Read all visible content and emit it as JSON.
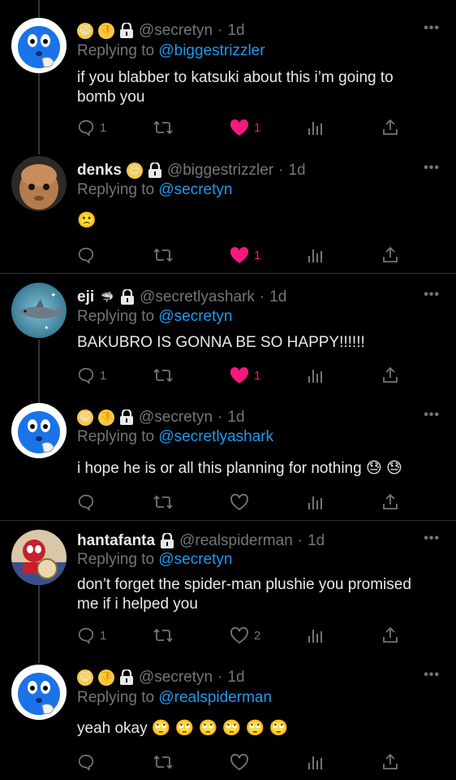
{
  "tweets": [
    {
      "author_name": "",
      "emojis": [
        "😹",
        "👎"
      ],
      "handle": "@secretyn",
      "time": "1d",
      "replying_prefix": "Replying to",
      "replying_to": "@biggestrizzler",
      "text_lines": [
        "if you blabber to katsuki about this i’m going to",
        "bomb you"
      ],
      "reply_count": "1",
      "retweet_count": "",
      "like_count": "1",
      "liked": true
    },
    {
      "author_name": "denks",
      "emojis": [
        "😊"
      ],
      "handle": "@biggestrizzler",
      "time": "1d",
      "replying_prefix": "Replying to",
      "replying_to": "@secretyn",
      "text_lines": [
        "🙁"
      ],
      "reply_count": "",
      "retweet_count": "",
      "like_count": "1",
      "liked": true
    },
    {
      "author_name": "eji",
      "emojis": [
        "🦈"
      ],
      "handle": "@secretlyashark",
      "time": "1d",
      "replying_prefix": "Replying to",
      "replying_to": "@secretyn",
      "text_lines": [
        "BAKUBRO IS GONNA BE SO HAPPY!!!!!!"
      ],
      "reply_count": "1",
      "retweet_count": "",
      "like_count": "1",
      "liked": true
    },
    {
      "author_name": "",
      "emojis": [
        "😹",
        "👎"
      ],
      "handle": "@secretyn",
      "time": "1d",
      "replying_prefix": "Replying to",
      "replying_to": "@secretlyashark",
      "text_lines": [
        "i hope he is or all this planning for nothing 😓 😓"
      ],
      "reply_count": "",
      "retweet_count": "",
      "like_count": "",
      "liked": false
    },
    {
      "author_name": "hantafanta",
      "emojis": [],
      "handle": "@realspiderman",
      "time": "1d",
      "replying_prefix": "Replying to",
      "replying_to": "@secretyn",
      "text_lines": [
        "don’t forget the spider-man plushie you promised",
        "me if i helped you"
      ],
      "reply_count": "1",
      "retweet_count": "",
      "like_count": "2",
      "liked": false
    },
    {
      "author_name": "",
      "emojis": [
        "😹",
        "👎"
      ],
      "handle": "@secretyn",
      "time": "1d",
      "replying_prefix": "Replying to",
      "replying_to": "@realspiderman",
      "text_lines": [
        "yeah okay 🙄 🙄 🙄 🙄 🙄 🙄"
      ],
      "reply_count": "",
      "retweet_count": "",
      "like_count": "",
      "liked": false
    }
  ],
  "separator": "·",
  "more_label": "•••",
  "colors": {
    "link": "#1d9bf0",
    "secondary": "#71767b",
    "like": "#f91880",
    "background": "#000000"
  }
}
